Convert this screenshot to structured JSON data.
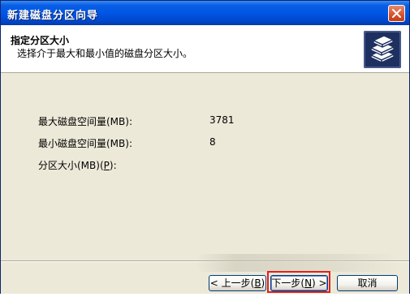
{
  "window": {
    "title": "新建磁盘分区向导"
  },
  "header": {
    "title": "指定分区大小",
    "subtitle": "选择介于最大和最小值的磁盘分区大小。"
  },
  "fields": {
    "max_label": "最大磁盘空间量(MB):",
    "max_value": "3781",
    "min_label": "最小磁盘空间量(MB):",
    "min_value": "8",
    "size_label_prefix": "分区大小(MB)(",
    "size_label_key": "P",
    "size_label_suffix": "):"
  },
  "buttons": {
    "back_prefix": "< 上一步(",
    "back_key": "B",
    "back_suffix": ")",
    "next_prefix": "下一步(",
    "next_key": "N",
    "next_suffix": ") >",
    "cancel": "取消"
  },
  "icons": {
    "close": "close-icon",
    "wizard": "disk-stack-icon"
  },
  "colors": {
    "titlebar": "#0054e3",
    "highlight": "#e41f1f",
    "dialog_bg": "#ece9d8"
  }
}
